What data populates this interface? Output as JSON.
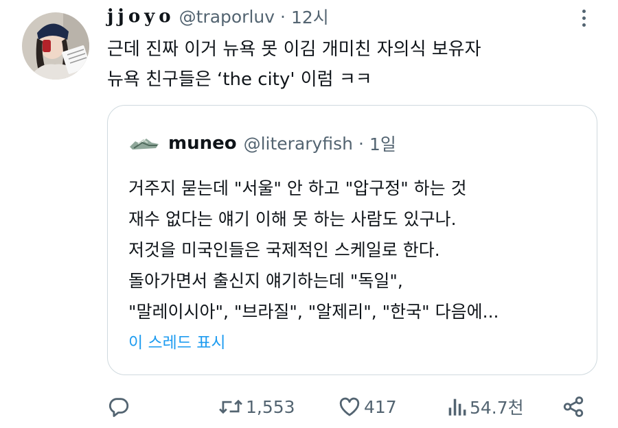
{
  "tweet": {
    "display_name": "jjoyo",
    "handle": "@traporluv",
    "separator": "·",
    "time": "12시",
    "lines": [
      "근데 진짜 이거 뉴욕 못 이김 개미친 자의식 보유자",
      "뉴욕 친구들은 ‘the city' 이럼 ㅋㅋ"
    ]
  },
  "quote": {
    "display_name": "muneo",
    "handle": "@literaryfish",
    "separator": "·",
    "time": "1일",
    "lines": [
      "거주지 묻는데 \"서울\" 안 하고 \"압구정\" 하는 것",
      "재수 없다는 얘기 이해 못 하는 사람도 있구나.",
      "저것을 미국인들은 국제적인 스케일로 한다.",
      "돌아가면서 출신지 얘기하는데 \"독일\",",
      "\"말레이시아\", \"브라질\", \"알제리\", \"한국\" 다음에..."
    ],
    "show_thread_label": "이 스레드 표시"
  },
  "actions": {
    "reply_count": "",
    "retweet_count": "1,553",
    "like_count": "417",
    "view_count": "54.7천"
  },
  "icons": {
    "more": "more-vertical-icon",
    "reply": "reply-icon",
    "retweet": "retweet-icon",
    "like": "heart-icon",
    "views": "bar-chart-icon",
    "share": "share-icon"
  },
  "colors": {
    "text": "#0f1419",
    "secondary": "#536471",
    "link": "#1d9bf0",
    "border": "#cfd9de"
  }
}
